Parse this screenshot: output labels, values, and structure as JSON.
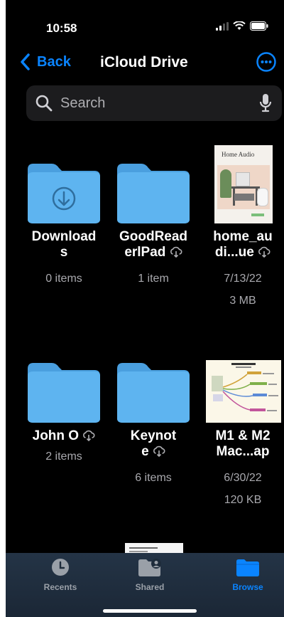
{
  "status_bar": {
    "time": "10:58"
  },
  "nav": {
    "back_label": "Back",
    "title": "iCloud Drive"
  },
  "search": {
    "placeholder": "Search"
  },
  "items": [
    {
      "name": "Download s",
      "meta1": "0 items",
      "meta2": "",
      "meta3": "",
      "icon": "download-folder-icon"
    },
    {
      "name": "GoodRead erlPad",
      "meta1": "1 item",
      "meta2": "",
      "meta3": "",
      "icon": "folder-icon"
    },
    {
      "name": "home_au di...ue",
      "meta1": "7/13/22",
      "meta2": "3 MB",
      "meta3": "",
      "icon": "document-thumbnail"
    },
    {
      "name": "John O",
      "meta1": "2 items",
      "meta2": "",
      "meta3": "",
      "icon": "folder-icon"
    },
    {
      "name": "Keynot e",
      "meta1": "6 items",
      "meta2": "",
      "meta3": "",
      "icon": "folder-icon"
    },
    {
      "name": "M1 & M2 Mac...ap",
      "meta1": "6/30/22",
      "meta2": "120 KB",
      "meta3": "",
      "icon": "document-thumbnail"
    }
  ],
  "thumbs": {
    "home_audio_title": "Home Audio"
  },
  "tabs": [
    {
      "label": "Recents",
      "icon": "clock-icon",
      "active": false
    },
    {
      "label": "Shared",
      "icon": "shared-folder-icon",
      "active": false
    },
    {
      "label": "Browse",
      "icon": "folder-icon",
      "active": true
    }
  ],
  "colors": {
    "accent": "#0a84ff",
    "folder": "#5eb4f0",
    "folder_dark": "#4a9fdf",
    "inactive_tab": "#9aa0a8"
  }
}
